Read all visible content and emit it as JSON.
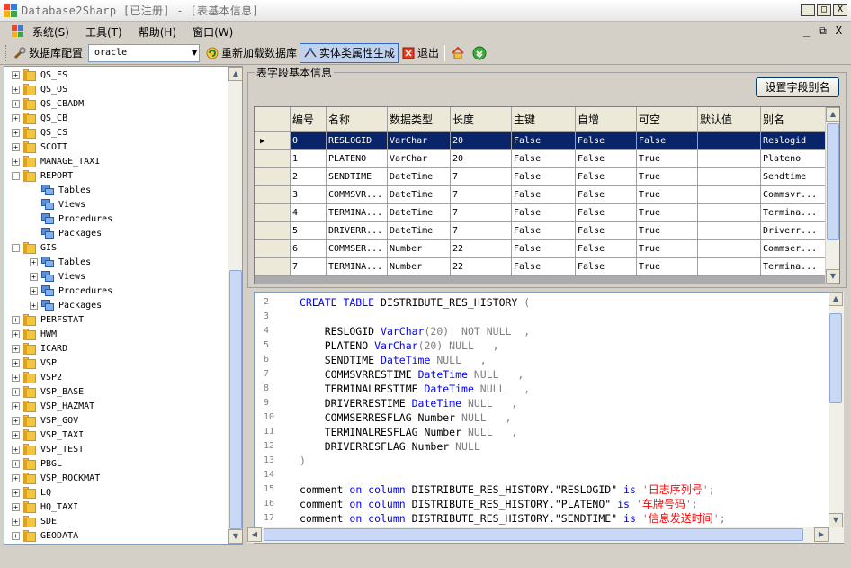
{
  "window": {
    "title": "Database2Sharp [已注册] - [表基本信息]",
    "controls": [
      "_",
      "□",
      "X"
    ]
  },
  "menu": {
    "items": [
      "系统(S)",
      "工具(T)",
      "帮助(H)",
      "窗口(W)"
    ],
    "mdi_controls": [
      "_",
      "⧉",
      "X"
    ]
  },
  "toolbar": {
    "db_config": "数据库配置",
    "db_select": "oracle",
    "reload": "重新加载数据库",
    "entity_gen": "实体类属性生成",
    "exit": "退出"
  },
  "tree": {
    "items": [
      {
        "label": "QS_ES",
        "level": 0,
        "expanded": false
      },
      {
        "label": "QS_OS",
        "level": 0,
        "expanded": false
      },
      {
        "label": "QS_CBADM",
        "level": 0,
        "expanded": false
      },
      {
        "label": "QS_CB",
        "level": 0,
        "expanded": false
      },
      {
        "label": "QS_CS",
        "level": 0,
        "expanded": false
      },
      {
        "label": "SCOTT",
        "level": 0,
        "expanded": false
      },
      {
        "label": "MANAGE_TAXI",
        "level": 0,
        "expanded": false
      },
      {
        "label": "REPORT",
        "level": 0,
        "expanded": true
      },
      {
        "label": "Tables",
        "level": 1,
        "leaf": true
      },
      {
        "label": "Views",
        "level": 1,
        "leaf": true
      },
      {
        "label": "Procedures",
        "level": 1,
        "leaf": true
      },
      {
        "label": "Packages",
        "level": 1,
        "leaf": true
      },
      {
        "label": "GIS",
        "level": 0,
        "expanded": true
      },
      {
        "label": "Tables",
        "level": 1,
        "leaf": false
      },
      {
        "label": "Views",
        "level": 1,
        "leaf": false
      },
      {
        "label": "Procedures",
        "level": 1,
        "leaf": false
      },
      {
        "label": "Packages",
        "level": 1,
        "leaf": false
      },
      {
        "label": "PERFSTAT",
        "level": 0,
        "expanded": false
      },
      {
        "label": "HWM",
        "level": 0,
        "expanded": false
      },
      {
        "label": "ICARD",
        "level": 0,
        "expanded": false
      },
      {
        "label": "VSP",
        "level": 0,
        "expanded": false
      },
      {
        "label": "VSP2",
        "level": 0,
        "expanded": false
      },
      {
        "label": "VSP_BASE",
        "level": 0,
        "expanded": false
      },
      {
        "label": "VSP_HAZMAT",
        "level": 0,
        "expanded": false
      },
      {
        "label": "VSP_GOV",
        "level": 0,
        "expanded": false
      },
      {
        "label": "VSP_TAXI",
        "level": 0,
        "expanded": false
      },
      {
        "label": "VSP_TEST",
        "level": 0,
        "expanded": false
      },
      {
        "label": "PBGL",
        "level": 0,
        "expanded": false
      },
      {
        "label": "VSP_ROCKMAT",
        "level": 0,
        "expanded": false
      },
      {
        "label": "LQ",
        "level": 0,
        "expanded": false
      },
      {
        "label": "HQ_TAXI",
        "level": 0,
        "expanded": false
      },
      {
        "label": "SDE",
        "level": 0,
        "expanded": false
      },
      {
        "label": "GEODATA",
        "level": 0,
        "expanded": false
      }
    ]
  },
  "fields_panel": {
    "title": "表字段基本信息",
    "alias_button": "设置字段别名",
    "columns": [
      "编号",
      "名称",
      "数据类型",
      "长度",
      "主键",
      "自增",
      "可空",
      "默认值",
      "别名"
    ],
    "rows": [
      [
        "0",
        "RESLOGID",
        "VarChar",
        "20",
        "False",
        "False",
        "False",
        "",
        "Reslogid"
      ],
      [
        "1",
        "PLATENO",
        "VarChar",
        "20",
        "False",
        "False",
        "True",
        "",
        "Plateno"
      ],
      [
        "2",
        "SENDTIME",
        "DateTime",
        "7",
        "False",
        "False",
        "True",
        "",
        "Sendtime"
      ],
      [
        "3",
        "COMMSVR...",
        "DateTime",
        "7",
        "False",
        "False",
        "True",
        "",
        "Commsvr..."
      ],
      [
        "4",
        "TERMINA...",
        "DateTime",
        "7",
        "False",
        "False",
        "True",
        "",
        "Termina..."
      ],
      [
        "5",
        "DRIVERR...",
        "DateTime",
        "7",
        "False",
        "False",
        "True",
        "",
        "Driverr..."
      ],
      [
        "6",
        "COMMSER...",
        "Number",
        "22",
        "False",
        "False",
        "True",
        "",
        "Commser..."
      ],
      [
        "7",
        "TERMINA...",
        "Number",
        "22",
        "False",
        "False",
        "True",
        "",
        "Termina..."
      ]
    ],
    "selected_row": 0
  },
  "code": {
    "lines": [
      {
        "n": "2",
        "parts": [
          [
            "kw",
            "CREATE TABLE "
          ],
          [
            "",
            "DISTRIBUTE_RES_HISTORY "
          ],
          [
            "gr",
            "("
          ]
        ]
      },
      {
        "n": "3",
        "parts": []
      },
      {
        "n": "4",
        "parts": [
          [
            "",
            "    RESLOGID "
          ],
          [
            "kw",
            "VarChar"
          ],
          [
            "gr",
            "(20)  NOT NULL  ,"
          ]
        ]
      },
      {
        "n": "5",
        "parts": [
          [
            "",
            "    PLATENO "
          ],
          [
            "kw",
            "VarChar"
          ],
          [
            "gr",
            "(20) NULL   ,"
          ]
        ]
      },
      {
        "n": "6",
        "parts": [
          [
            "",
            "    SENDTIME "
          ],
          [
            "kw",
            "DateTime"
          ],
          [
            "gr",
            " NULL   ,"
          ]
        ]
      },
      {
        "n": "7",
        "parts": [
          [
            "",
            "    COMMSVRRESTIME "
          ],
          [
            "kw",
            "DateTime"
          ],
          [
            "gr",
            " NULL   ,"
          ]
        ]
      },
      {
        "n": "8",
        "parts": [
          [
            "",
            "    TERMINALRESTIME "
          ],
          [
            "kw",
            "DateTime"
          ],
          [
            "gr",
            " NULL   ,"
          ]
        ]
      },
      {
        "n": "9",
        "parts": [
          [
            "",
            "    DRIVERRESTIME "
          ],
          [
            "kw",
            "DateTime"
          ],
          [
            "gr",
            " NULL   ,"
          ]
        ]
      },
      {
        "n": "10",
        "parts": [
          [
            "",
            "    COMMSERRESFLAG Number "
          ],
          [
            "gr",
            "NULL   ,"
          ]
        ]
      },
      {
        "n": "11",
        "parts": [
          [
            "",
            "    TERMINALRESFLAG Number "
          ],
          [
            "gr",
            "NULL   ,"
          ]
        ]
      },
      {
        "n": "12",
        "parts": [
          [
            "",
            "    DRIVERRESFLAG Number "
          ],
          [
            "gr",
            "NULL"
          ]
        ]
      },
      {
        "n": "13",
        "parts": [
          [
            "gr",
            ")"
          ]
        ]
      },
      {
        "n": "14",
        "parts": []
      },
      {
        "n": "15",
        "parts": [
          [
            "",
            "comment "
          ],
          [
            "kw",
            "on column "
          ],
          [
            "",
            "DISTRIBUTE_RES_HISTORY.\"RESLOGID\" "
          ],
          [
            "kw",
            "is "
          ],
          [
            "gr",
            "'"
          ],
          [
            "rd",
            "日志序列号"
          ],
          [
            "gr",
            "';"
          ]
        ]
      },
      {
        "n": "16",
        "parts": [
          [
            "",
            "comment "
          ],
          [
            "kw",
            "on column "
          ],
          [
            "",
            "DISTRIBUTE_RES_HISTORY.\"PLATENO\" "
          ],
          [
            "kw",
            "is "
          ],
          [
            "gr",
            "'"
          ],
          [
            "rd",
            "车牌号码"
          ],
          [
            "gr",
            "';"
          ]
        ]
      },
      {
        "n": "17",
        "parts": [
          [
            "",
            "comment "
          ],
          [
            "kw",
            "on column "
          ],
          [
            "",
            "DISTRIBUTE_RES_HISTORY.\"SENDTIME\" "
          ],
          [
            "kw",
            "is "
          ],
          [
            "gr",
            "'"
          ],
          [
            "rd",
            "信息发送时间"
          ],
          [
            "gr",
            "';"
          ]
        ]
      }
    ]
  }
}
